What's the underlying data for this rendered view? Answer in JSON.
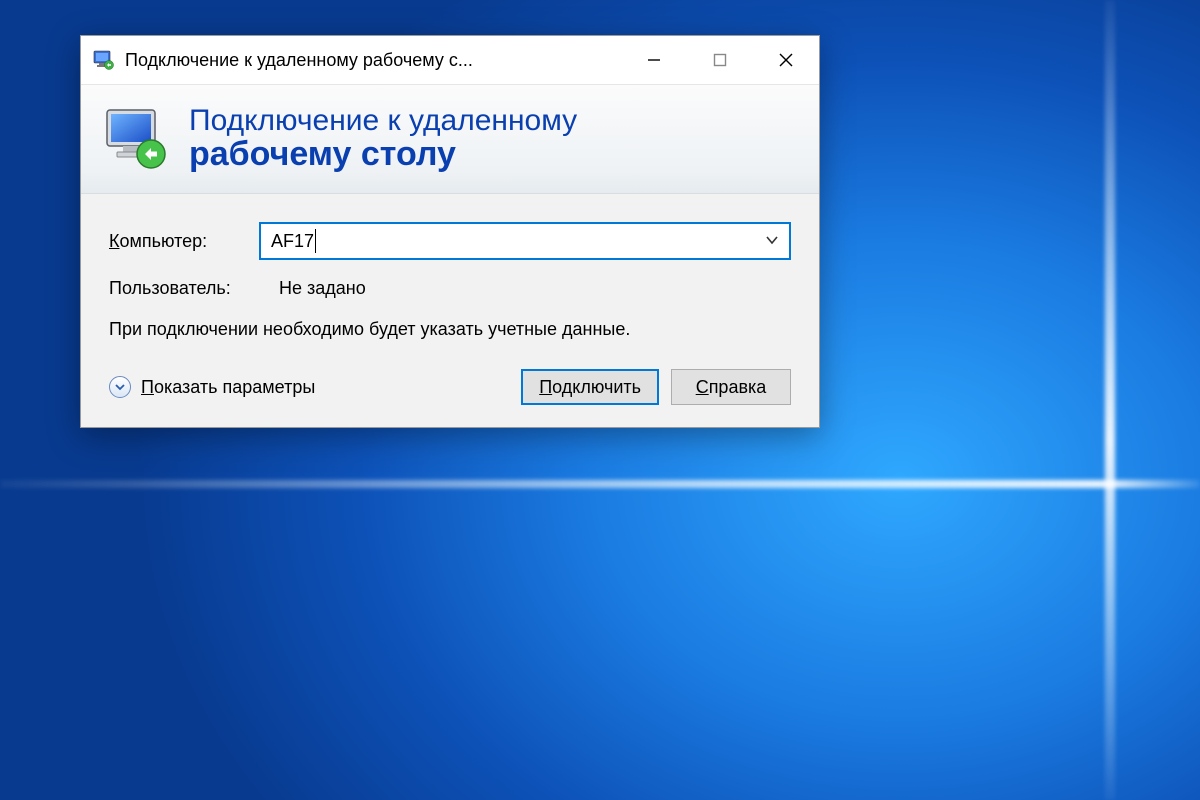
{
  "titlebar": {
    "title": "Подключение к удаленному рабочему с..."
  },
  "header": {
    "line1": "Подключение к удаленному",
    "line2": "рабочему столу"
  },
  "form": {
    "computer_label": "Компьютер:",
    "computer_value": "AF17",
    "user_label": "Пользователь:",
    "user_value": "Не задано",
    "info": "При подключении необходимо будет указать учетные данные."
  },
  "footer": {
    "show_options": "Показать параметры",
    "connect": "Подключить",
    "help": "Справка"
  }
}
